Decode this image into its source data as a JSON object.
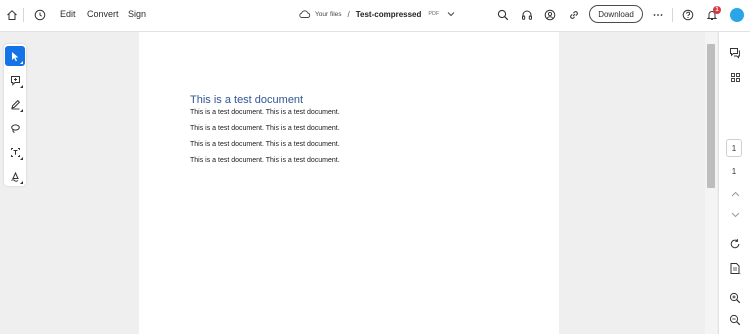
{
  "topbar": {
    "menu": [
      "Edit",
      "Convert",
      "Sign"
    ],
    "breadcrumb": {
      "location": "Your files",
      "separator": "/",
      "file_name": "Test-compressed",
      "file_type": "PDF"
    },
    "download_label": "Download",
    "notification_count": "1",
    "accent_color": "#1473e6",
    "avatar_color": "#2aa5e8"
  },
  "left_tools": [
    "select-tool",
    "comment-tool",
    "draw-tool",
    "lasso-tool",
    "text-select-tool",
    "sign-tool"
  ],
  "document": {
    "title": "This is a test document",
    "lines": [
      "This is a test document. This is a test document.",
      "This is a test document. This is a test document.",
      "This is a test document. This is a test document.",
      "This is a test document. This is a test document."
    ]
  },
  "pager": {
    "current_page": "1",
    "total_pages": "1"
  }
}
